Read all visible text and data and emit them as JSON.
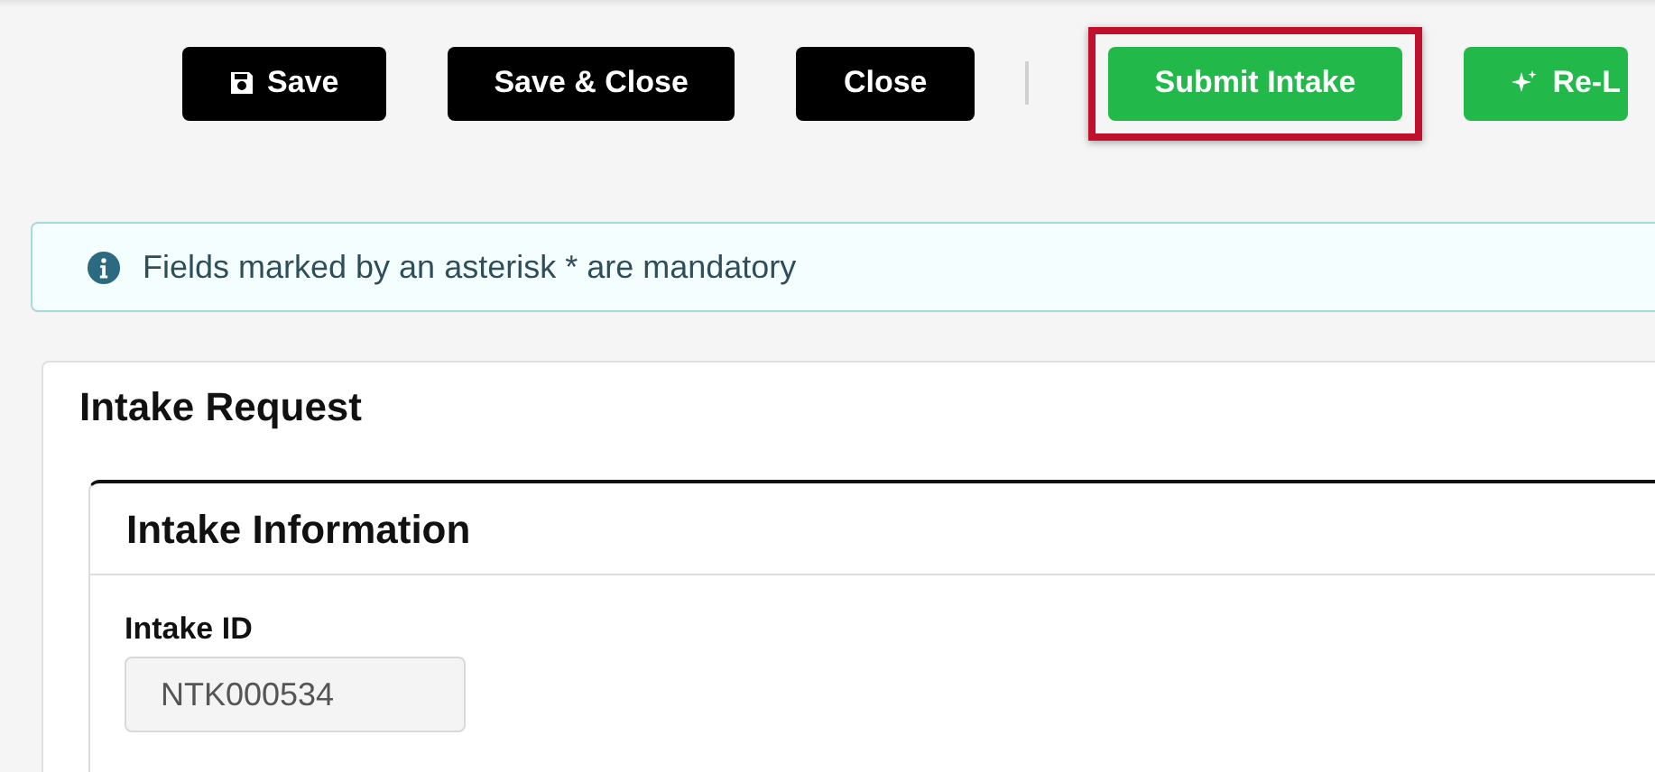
{
  "toolbar": [
    {
      "kind": "dark",
      "label": "Save",
      "highlighted": false
    },
    {
      "kind": "dark",
      "label": "Save & Close",
      "highlighted": false
    },
    {
      "kind": "dark",
      "label": "Close",
      "highlighted": false
    },
    {
      "kind": "separator"
    },
    {
      "kind": "green",
      "label": "Submit Intake",
      "highlighted": true
    },
    {
      "kind": "green",
      "label": "Re-L",
      "highlighted": false
    }
  ],
  "notice": {
    "text": "Fields marked by an asterisk * are mandatory"
  },
  "card": {
    "title": "Intake Request",
    "section": {
      "title": "Intake Information",
      "fields": [
        {
          "label": "Intake ID",
          "value": "NTK000534",
          "disabled": true
        }
      ]
    }
  }
}
